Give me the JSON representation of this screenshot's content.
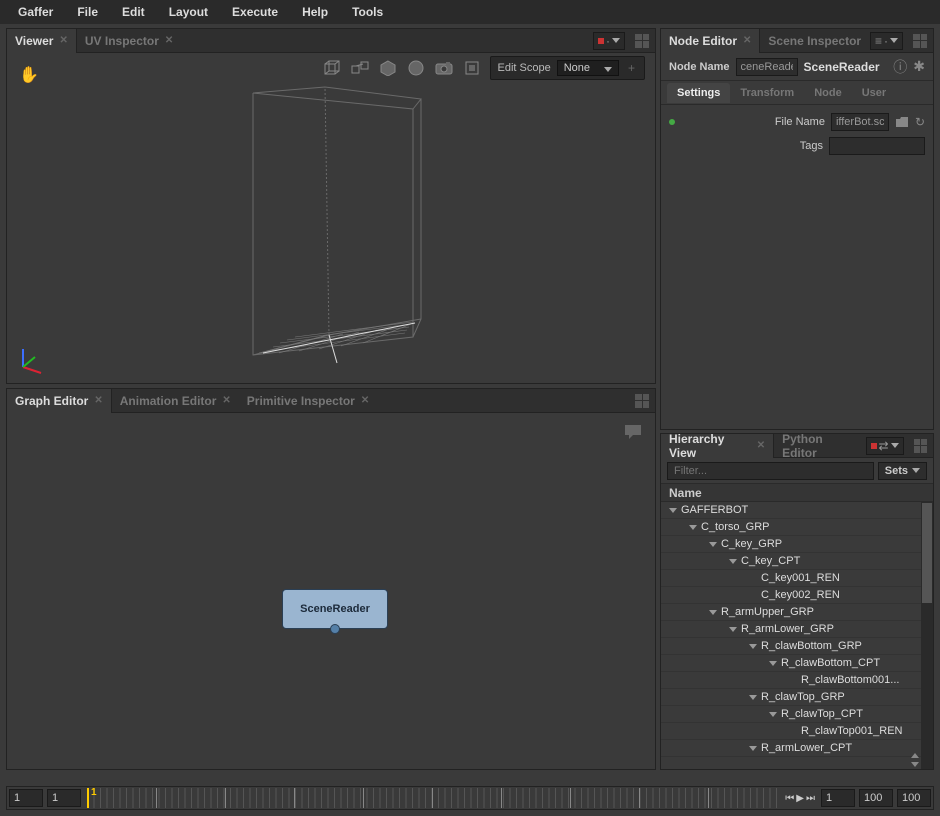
{
  "menubar": [
    "Gaffer",
    "File",
    "Edit",
    "Layout",
    "Execute",
    "Help",
    "Tools"
  ],
  "viewer": {
    "tab_active": "Viewer",
    "tab_inactive": "UV Inspector",
    "editscope_label": "Edit Scope",
    "editscope_value": "None"
  },
  "graph": {
    "tab_active": "Graph Editor",
    "tab2": "Animation Editor",
    "tab3": "Primitive Inspector",
    "node_label": "SceneReader"
  },
  "node_editor": {
    "tab_active": "Node Editor",
    "tab_inactive": "Scene Inspector",
    "nodename_label": "Node Name",
    "nodename_value": "ceneReader",
    "title": "SceneReader",
    "section_tabs": [
      "Settings",
      "Transform",
      "Node",
      "User"
    ],
    "filename_label": "File Name",
    "filename_value": "ifferBot.scc",
    "tags_label": "Tags",
    "tags_value": ""
  },
  "hierarchy": {
    "tab_active": "Hierarchy View",
    "tab_inactive": "Python Editor",
    "filter_placeholder": "Filter...",
    "sets_label": "Sets",
    "header": "Name",
    "items": [
      {
        "depth": 0,
        "exp": true,
        "label": "GAFFERBOT"
      },
      {
        "depth": 1,
        "exp": true,
        "label": "C_torso_GRP"
      },
      {
        "depth": 2,
        "exp": true,
        "label": "C_key_GRP"
      },
      {
        "depth": 3,
        "exp": true,
        "label": "C_key_CPT"
      },
      {
        "depth": 4,
        "exp": false,
        "label": "C_key001_REN"
      },
      {
        "depth": 4,
        "exp": false,
        "label": "C_key002_REN"
      },
      {
        "depth": 2,
        "exp": true,
        "label": "R_armUpper_GRP"
      },
      {
        "depth": 3,
        "exp": true,
        "label": "R_armLower_GRP"
      },
      {
        "depth": 4,
        "exp": true,
        "label": "R_clawBottom_GRP"
      },
      {
        "depth": 5,
        "exp": true,
        "label": "R_clawBottom_CPT"
      },
      {
        "depth": 6,
        "exp": false,
        "label": "R_clawBottom001..."
      },
      {
        "depth": 4,
        "exp": true,
        "label": "R_clawTop_GRP"
      },
      {
        "depth": 5,
        "exp": true,
        "label": "R_clawTop_CPT"
      },
      {
        "depth": 6,
        "exp": false,
        "label": "R_clawTop001_REN"
      },
      {
        "depth": 4,
        "exp": true,
        "label": "R_armLower_CPT"
      }
    ]
  },
  "timeline": {
    "start_range": "1",
    "start_frame": "1",
    "playhead": "1",
    "current": "1",
    "end_frame": "100",
    "end_range": "100"
  }
}
